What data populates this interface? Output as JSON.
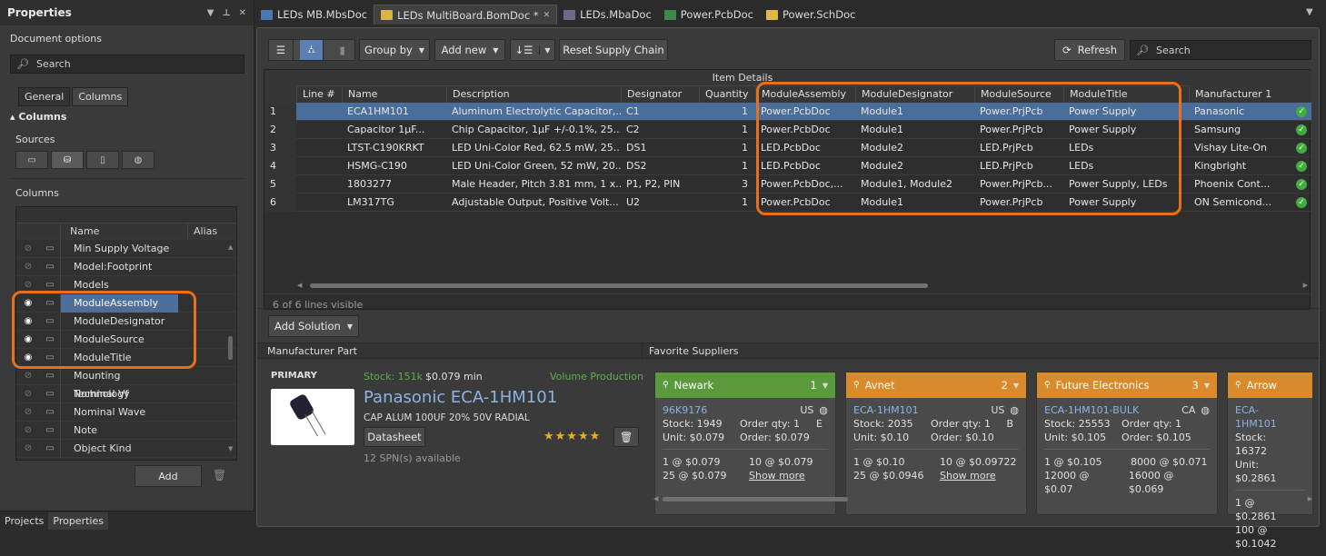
{
  "left": {
    "title": "Properties",
    "header_controls": [
      "▼",
      "⊥",
      "✕"
    ],
    "doc_options": "Document options",
    "search_placeholder": "Search",
    "tabs": [
      "General",
      "Columns"
    ],
    "section": "Columns",
    "sources_label": "Sources",
    "columns_label": "Columns",
    "col_headers": {
      "name": "Name",
      "alias": "Alias"
    },
    "rows": [
      {
        "name": "Min Supply Voltage",
        "visible": false
      },
      {
        "name": "Model:Footprint",
        "visible": false
      },
      {
        "name": "Models",
        "visible": false
      },
      {
        "name": "ModuleAssembly",
        "visible": true
      },
      {
        "name": "ModuleDesignator",
        "visible": true
      },
      {
        "name": "ModuleSource",
        "visible": true
      },
      {
        "name": "ModuleTitle",
        "visible": true
      },
      {
        "name": "Mounting Technology",
        "visible": false
      },
      {
        "name": "Nominal Vf",
        "visible": false
      },
      {
        "name": "Nominal Wave",
        "visible": false
      },
      {
        "name": "Note",
        "visible": false
      },
      {
        "name": "Object Kind",
        "visible": false
      }
    ],
    "add_label": "Add",
    "bottom_tabs": [
      "Projects",
      "Properties"
    ]
  },
  "doctabs": [
    "LEDs MB.MbsDoc",
    "LEDs MultiBoard.BomDoc *",
    "LEDs.MbaDoc",
    "Power.PcbDoc",
    "Power.SchDoc"
  ],
  "toolbar": {
    "group_by": "Group by",
    "add_new": "Add new",
    "reset": "Reset Supply Chain",
    "refresh": "Refresh",
    "search_placeholder": "Search"
  },
  "grid": {
    "group_header": "Item Details",
    "columns": [
      "Line #",
      "Name",
      "Description",
      "Designator",
      "Quantity",
      "ModuleAssembly",
      "ModuleDesignator",
      "ModuleSource",
      "ModuleTitle",
      "Manufacturer 1"
    ],
    "rows": [
      [
        "1",
        "ECA1HM101",
        "Aluminum Electrolytic Capacitor,...",
        "C1",
        "1",
        "Power.PcbDoc",
        "Module1",
        "Power.PrjPcb",
        "Power Supply",
        "Panasonic"
      ],
      [
        "2",
        "Capacitor 1µF...",
        "Chip Capacitor, 1µF +/-0.1%, 25...",
        "C2",
        "1",
        "Power.PcbDoc",
        "Module1",
        "Power.PrjPcb",
        "Power Supply",
        "Samsung"
      ],
      [
        "3",
        "LTST-C190KRKT",
        "LED Uni-Color Red, 62.5 mW, 25...",
        "DS1",
        "1",
        "LED.PcbDoc",
        "Module2",
        "LED.PrjPcb",
        "LEDs",
        "Vishay Lite-On"
      ],
      [
        "4",
        "HSMG-C190",
        "LED Uni-Color Green, 52 mW, 20...",
        "DS2",
        "1",
        "LED.PcbDoc",
        "Module2",
        "LED.PrjPcb",
        "LEDs",
        "Kingbright"
      ],
      [
        "5",
        "1803277",
        "Male Header, Pitch 3.81 mm, 1 x...",
        "P1, P2, PIN",
        "3",
        "Power.PcbDoc,...",
        "Module1, Module2",
        "Power.PrjPcb...",
        "Power Supply, LEDs",
        "Phoenix Cont..."
      ],
      [
        "6",
        "LM317TG",
        "Adjustable Output, Positive Volt...",
        "U2",
        "1",
        "Power.PcbDoc",
        "Module1",
        "Power.PrjPcb",
        "Power Supply",
        "ON Semicond..."
      ]
    ],
    "status": "6 of 6 lines visible"
  },
  "solution": {
    "add_solution": "Add Solution",
    "manufacturer_part": "Manufacturer Part",
    "favorite_suppliers": "Favorite Suppliers",
    "primary": "PRIMARY",
    "stock": "Stock: 151k",
    "price": "$0.079 min",
    "lifecycle": "Volume Production",
    "part_title": "Panasonic ECA-1HM101",
    "part_desc": "CAP ALUM 100UF 20% 50V RADIAL",
    "datasheet": "Datasheet",
    "spn": "12 SPN(s) available",
    "stars": "★★★★★"
  },
  "suppliers": [
    {
      "name": "Newark",
      "rank": "1",
      "color": "#5a9a3c",
      "sku": "96K9176",
      "country": "US",
      "stock": "Stock: 1949",
      "unit": "Unit: $0.079",
      "order": "Order qty: 1",
      "order_price": "Order: $0.079",
      "extra": "E",
      "p1a": "1 @ $0.079",
      "p1b": "10 @ $0.079",
      "p2a": "25 @ $0.079",
      "more": "Show more"
    },
    {
      "name": "Avnet",
      "rank": "2",
      "color": "#d98a2a",
      "sku": "ECA-1HM101",
      "country": "US",
      "stock": "Stock: 2035",
      "unit": "Unit: $0.10",
      "order": "Order qty: 1",
      "order_price": "Order: $0.10",
      "extra": "B",
      "p1a": "1 @ $0.10",
      "p1b": "10 @ $0.09722",
      "p2a": "25 @ $0.0946",
      "more": "Show more"
    },
    {
      "name": "Future Electronics",
      "rank": "3",
      "color": "#d98a2a",
      "sku": "ECA-1HM101-BULK",
      "country": "CA",
      "stock": "Stock: 25553",
      "unit": "Unit: $0.105",
      "order": "Order qty: 1",
      "order_price": "Order: $0.105",
      "extra": "",
      "p1a": "1 @ $0.105",
      "p1b": "8000 @ $0.071",
      "p2a": "12000 @ $0.07",
      "p2b": "16000 @ $0.069",
      "more": ""
    },
    {
      "name": "Arrow",
      "rank": "",
      "color": "#d98a2a",
      "sku": "ECA-1HM101",
      "country": "",
      "stock": "Stock: 16372",
      "unit": "Unit: $0.2861",
      "order": "",
      "order_price": "",
      "extra": "",
      "p1a": "1 @ $0.2861",
      "p1b": "",
      "p2a": "100 @ $0.1042",
      "more": ""
    }
  ],
  "colors": {
    "accent": "#e8701c",
    "selected": "#4a6e9c"
  }
}
